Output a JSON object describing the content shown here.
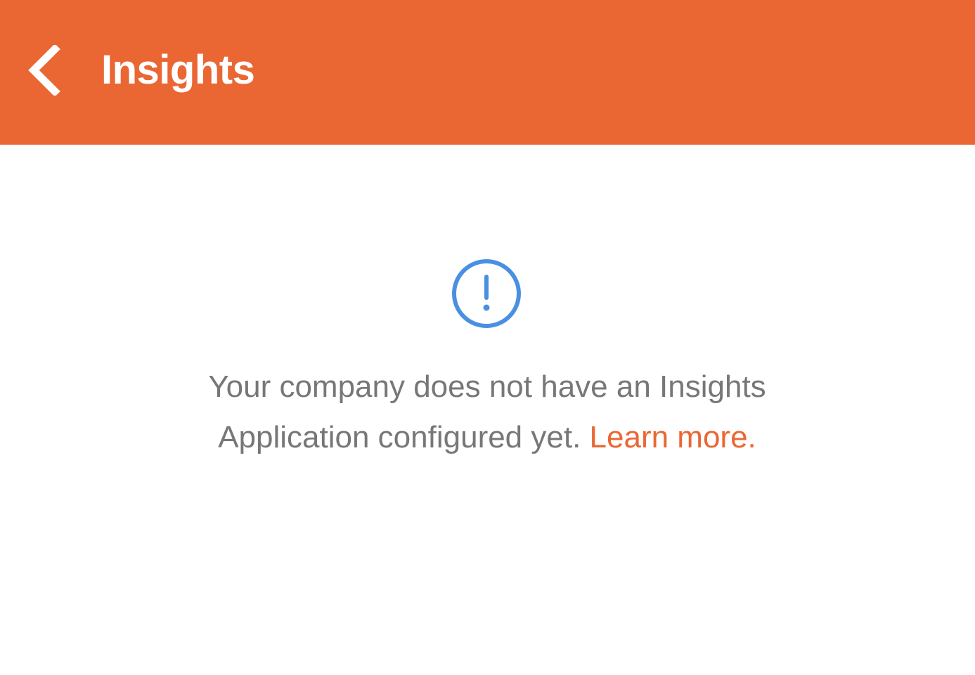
{
  "header": {
    "title": "Insights",
    "back_icon": "chevron-left-icon",
    "background_color": "#EA6733"
  },
  "main": {
    "alert_icon": "exclamation-circle-icon",
    "alert_icon_color": "#4A90E2",
    "message_line1": "Your company does not have an Insights",
    "message_line2": "Application configured yet.",
    "learn_more_label": "Learn more.",
    "link_color": "#EA6733"
  }
}
